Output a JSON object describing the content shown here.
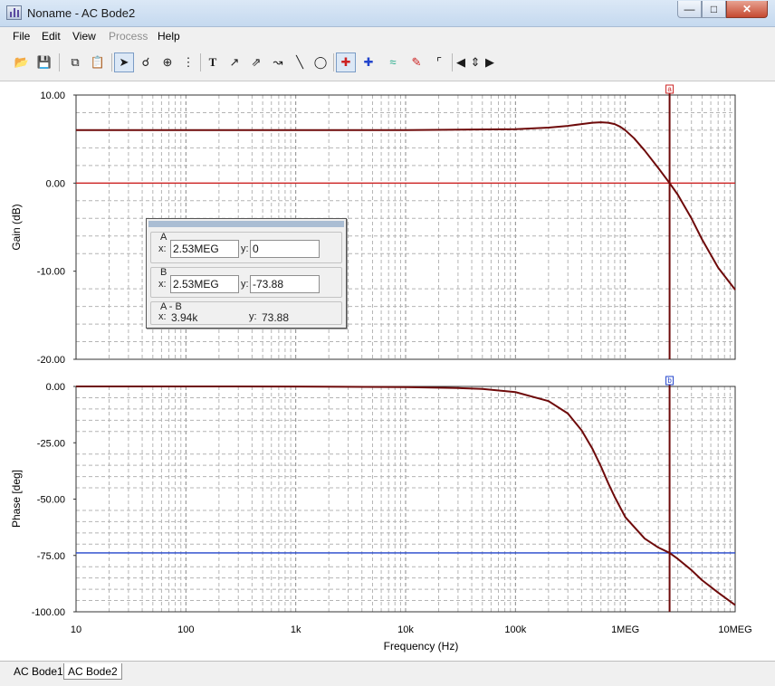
{
  "window": {
    "title": "Noname - AC Bode2"
  },
  "menu": [
    {
      "label": "File",
      "enabled": true
    },
    {
      "label": "Edit",
      "enabled": true
    },
    {
      "label": "View",
      "enabled": true
    },
    {
      "label": "Process",
      "enabled": false
    },
    {
      "label": "Help",
      "enabled": true
    }
  ],
  "toolbar": {
    "icons": [
      "open-icon",
      "save-icon",
      "copy-icon",
      "paste-icon",
      "pointer-icon",
      "zoom-in-icon",
      "zoom-100-icon",
      "grid-icon",
      "text-icon",
      "label-icon",
      "comment-icon",
      "annotation-icon",
      "line-icon",
      "ellipse-icon",
      "cursor-a-icon",
      "cursor-b-icon",
      "curves-icon",
      "marker-icon",
      "function-icon",
      "left-arrow-icon",
      "up-down-arrow-icon",
      "right-arrow-icon"
    ],
    "selected": [
      "pointer-icon",
      "cursor-a-icon"
    ]
  },
  "cursor_panel": {
    "a": {
      "title": "A",
      "x_label": "x:",
      "x_value": "2.53MEG",
      "y_label": "y:",
      "y_value": "0"
    },
    "b": {
      "title": "B",
      "x_label": "x:",
      "x_value": "2.53MEG",
      "y_label": "y:",
      "y_value": "-73.88"
    },
    "diff": {
      "title": "A - B",
      "x_label": "x:",
      "x_value": "3.94k",
      "y_label": "y:",
      "y_value": "73.88"
    }
  },
  "tabs": [
    {
      "label": "AC Bode1",
      "active": false
    },
    {
      "label": "AC Bode2",
      "active": true
    }
  ],
  "colors": {
    "trace": "#6e0a0a",
    "cursor_a": "#cc2222",
    "cursor_b": "#2244cc",
    "cursor_line": "#6e0a0a",
    "grid": "#b4b4b4"
  },
  "chart_data": [
    {
      "type": "line",
      "xlabel": "",
      "ylabel": "Gain (dB)",
      "xscale": "log",
      "xlim": [
        10,
        10000000
      ],
      "ylim": [
        -20,
        10
      ],
      "yticks": [
        10,
        0,
        -10,
        -20
      ],
      "ytick_labels": [
        "10.00",
        "0.00",
        "-10.00",
        "-20.00"
      ],
      "grid": true,
      "series": [
        {
          "x": [
            10,
            100,
            1000,
            10000,
            100000,
            200000,
            300000,
            400000,
            500000,
            600000,
            700000,
            800000,
            900000,
            1000000,
            1200000,
            1500000,
            2000000,
            2530000,
            3000000,
            4000000,
            5000000,
            7000000,
            10000000
          ],
          "y": [
            6.02,
            6.02,
            6.02,
            6.02,
            6.12,
            6.3,
            6.5,
            6.7,
            6.85,
            6.9,
            6.85,
            6.7,
            6.4,
            6.0,
            5.1,
            3.7,
            1.7,
            0.0,
            -1.3,
            -4.0,
            -6.4,
            -9.6,
            -12.1
          ]
        }
      ],
      "cursors": [
        {
          "label": "a",
          "x": 2530000,
          "y": 0
        }
      ]
    },
    {
      "type": "line",
      "xlabel": "Frequency (Hz)",
      "ylabel": "Phase [deg]",
      "xscale": "log",
      "xlim": [
        10,
        10000000
      ],
      "ylim": [
        -100,
        0
      ],
      "xticks": [
        10,
        100,
        1000,
        10000,
        100000,
        1000000,
        10000000
      ],
      "xtick_labels": [
        "10",
        "100",
        "1k",
        "10k",
        "100k",
        "1MEG",
        "10MEG"
      ],
      "yticks": [
        0,
        -25,
        -50,
        -75,
        -100
      ],
      "ytick_labels": [
        "0.00",
        "-25.00",
        "-50.00",
        "-75.00",
        "-100.00"
      ],
      "grid": true,
      "series": [
        {
          "x": [
            10,
            100,
            1000,
            10000,
            30000,
            50000,
            100000,
            200000,
            300000,
            400000,
            500000,
            600000,
            700000,
            800000,
            1000000,
            1500000,
            2000000,
            2530000,
            3000000,
            4000000,
            5000000,
            7000000,
            10000000
          ],
          "y": [
            0,
            0,
            -0.05,
            -0.3,
            -0.7,
            -1.1,
            -2.5,
            -6.5,
            -12,
            -19.5,
            -27.5,
            -35.5,
            -43,
            -49,
            -58,
            -67.5,
            -71.5,
            -73.88,
            -76.5,
            -81.5,
            -86,
            -91.5,
            -97
          ]
        }
      ],
      "cursors": [
        {
          "label": "b",
          "x": 2530000,
          "y": -73.88
        }
      ]
    }
  ]
}
